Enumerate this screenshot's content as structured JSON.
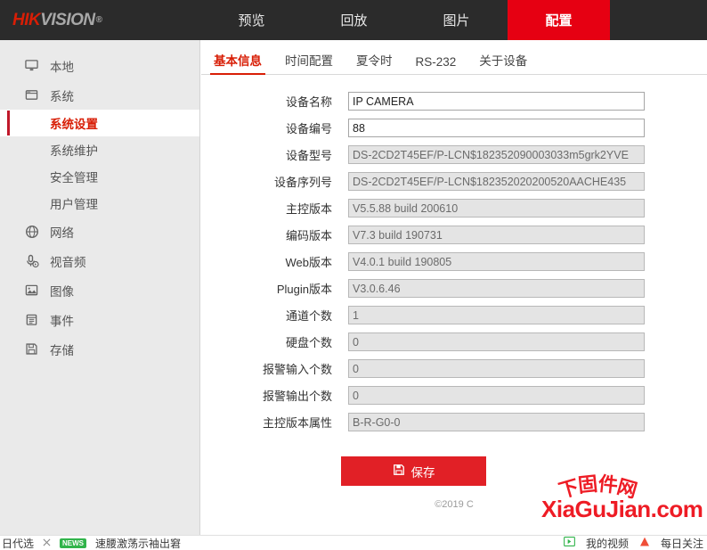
{
  "header": {
    "logo_hik": "HIK",
    "logo_vision": "VISION",
    "logo_reg": "®",
    "nav": [
      {
        "label": "预览",
        "active": false
      },
      {
        "label": "回放",
        "active": false
      },
      {
        "label": "图片",
        "active": false
      },
      {
        "label": "配置",
        "active": true
      }
    ]
  },
  "sidebar": {
    "items": [
      {
        "label": "本地",
        "icon": "monitor-icon"
      },
      {
        "label": "系统",
        "icon": "window-icon"
      }
    ],
    "sub_items": [
      {
        "label": "系统设置",
        "active": true
      },
      {
        "label": "系统维护",
        "active": false
      },
      {
        "label": "安全管理",
        "active": false
      },
      {
        "label": "用户管理",
        "active": false
      }
    ],
    "items_after": [
      {
        "label": "网络",
        "icon": "globe-icon"
      },
      {
        "label": "视音频",
        "icon": "microphone-icon"
      },
      {
        "label": "图像",
        "icon": "picture-icon"
      },
      {
        "label": "事件",
        "icon": "calendar-icon"
      },
      {
        "label": "存储",
        "icon": "save-disk-icon"
      }
    ]
  },
  "main": {
    "tabs": [
      {
        "label": "基本信息",
        "active": true
      },
      {
        "label": "时间配置",
        "active": false
      },
      {
        "label": "夏令时",
        "active": false
      },
      {
        "label": "RS-232",
        "active": false
      },
      {
        "label": "关于设备",
        "active": false
      }
    ],
    "fields": [
      {
        "label": "设备名称",
        "value": "IP CAMERA",
        "readonly": false
      },
      {
        "label": "设备编号",
        "value": "88",
        "readonly": false
      },
      {
        "label": "设备型号",
        "value": "DS-2CD2T45EF/P-LCN$182352090003033m5grk2YVE",
        "readonly": true
      },
      {
        "label": "设备序列号",
        "value": "DS-2CD2T45EF/P-LCN$182352020200520AACHE435",
        "readonly": true
      },
      {
        "label": "主控版本",
        "value": "V5.5.88 build 200610",
        "readonly": true
      },
      {
        "label": "编码版本",
        "value": "V7.3 build 190731",
        "readonly": true
      },
      {
        "label": "Web版本",
        "value": "V4.0.1 build 190805",
        "readonly": true
      },
      {
        "label": "Plugin版本",
        "value": "V3.0.6.46",
        "readonly": true
      },
      {
        "label": "通道个数",
        "value": "1",
        "readonly": true
      },
      {
        "label": "硬盘个数",
        "value": "0",
        "readonly": true
      },
      {
        "label": "报警输入个数",
        "value": "0",
        "readonly": true
      },
      {
        "label": "报警输出个数",
        "value": "0",
        "readonly": true
      },
      {
        "label": "主控版本属性",
        "value": "B-R-G0-0",
        "readonly": true
      }
    ],
    "save_label": "保存",
    "save_icon": "floppy-disk-icon"
  },
  "footer": {
    "copyright": "©2019                              C"
  },
  "watermark": {
    "arc_text": "下固件网",
    "main_text": "XiaGuJian.com",
    "color": "#ee1c25"
  },
  "bottom_strip": {
    "left_text": "日代选",
    "close_icon": "close-icon",
    "news_badge": "NEWS",
    "news_text": "速腰激荡示袖出窘",
    "right_items": [
      {
        "icon": "video-icon",
        "label": "我的视频"
      },
      {
        "icon": "flame-icon",
        "label": "每日关注"
      }
    ]
  },
  "colors": {
    "brand_red": "#e60012",
    "accent_red": "#d81e06",
    "header_bg": "#2b2b2b",
    "sidebar_bg": "#eaeaea"
  }
}
